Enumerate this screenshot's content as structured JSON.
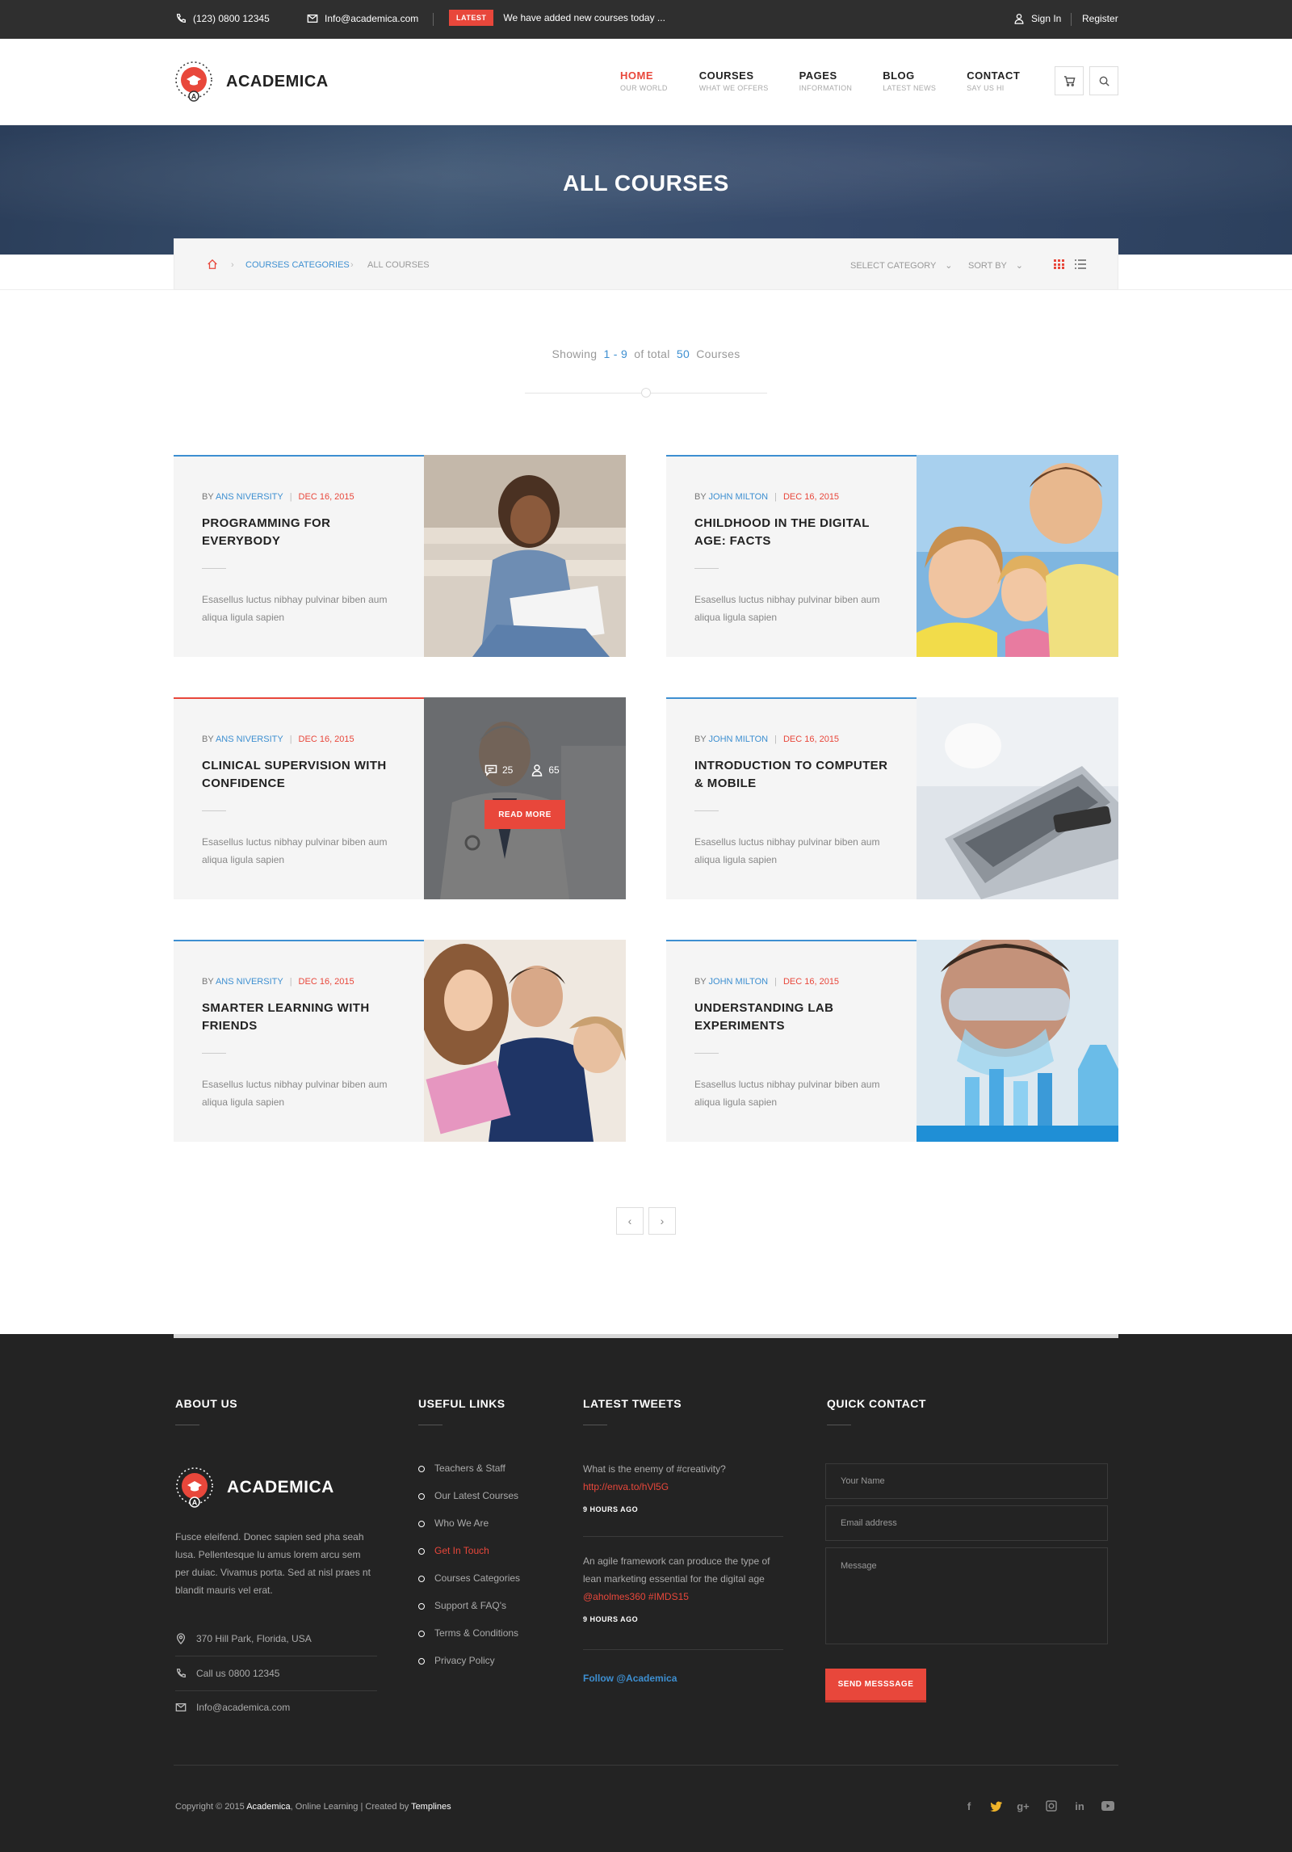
{
  "topbar": {
    "phone": "(123) 0800 12345",
    "email": "Info@academica.com",
    "latest_badge": "LATEST",
    "latest_text": "We have added new courses today ...",
    "sign_in": "Sign In",
    "register": "Register"
  },
  "brand": {
    "name": "ACADEMICA",
    "logo_letter": "A"
  },
  "nav": [
    {
      "title": "HOME",
      "sub": "OUR WORLD"
    },
    {
      "title": "COURSES",
      "sub": "WHAT WE OFFERS"
    },
    {
      "title": "PAGES",
      "sub": "INFORMATION"
    },
    {
      "title": "BLOG",
      "sub": "LATEST NEWS"
    },
    {
      "title": "CONTACT",
      "sub": "SAY US HI"
    }
  ],
  "hero": {
    "title": "ALL COURSES"
  },
  "breadcrumb": {
    "category": "COURSES CATEGORIES",
    "current": "ALL COURSES",
    "select_category": "SELECT CATEGORY",
    "sort_by": "SORT BY"
  },
  "showing": {
    "prefix": "Showing",
    "range": "1 - 9",
    "of_total": "of  total",
    "total": "50",
    "suffix": "Courses"
  },
  "courses": [
    {
      "by": "BY",
      "author": "ANS NIVERSITY",
      "date": "DEC 16, 2015",
      "title": "PROGRAMMING FOR EVERYBODY",
      "desc": "Esasellus luctus nibhay pulvinar biben aum aliqua ligula sapien"
    },
    {
      "by": "BY",
      "author": "JOHN MILTON",
      "date": "DEC 16, 2015",
      "title": "CHILDHOOD IN THE DIGITAL AGE: FACTS",
      "desc": "Esasellus luctus nibhay pulvinar biben aum aliqua ligula sapien"
    },
    {
      "by": "BY",
      "author": "ANS NIVERSITY",
      "date": "DEC 16, 2015",
      "title": "CLINICAL SUPERVISION WITH CONFIDENCE",
      "desc": "Esasellus luctus nibhay pulvinar biben aum aliqua ligula sapien",
      "comments": "25",
      "students": "65",
      "read_more": "READ MORE"
    },
    {
      "by": "BY",
      "author": "JOHN MILTON",
      "date": "DEC 16, 2015",
      "title": "INTRODUCTION TO COMPUTER & MOBILE",
      "desc": "Esasellus luctus nibhay pulvinar biben aum aliqua ligula sapien"
    },
    {
      "by": "BY",
      "author": "ANS NIVERSITY",
      "date": "DEC 16, 2015",
      "title": "SMARTER LEARNING WITH FRIENDS",
      "desc": "Esasellus luctus nibhay pulvinar biben aum aliqua ligula sapien"
    },
    {
      "by": "BY",
      "author": "JOHN MILTON",
      "date": "DEC 16, 2015",
      "title": "UNDERSTANDING LAB EXPERIMENTS",
      "desc": "Esasellus luctus nibhay pulvinar biben aum aliqua ligula sapien"
    }
  ],
  "pager": {
    "prev": "‹",
    "next": "›"
  },
  "footer": {
    "about_title": "ABOUT US",
    "links_title": "USEFUL LINKS",
    "tweets_title": "LATEST TWEETS",
    "contact_title": "QUICK CONTACT",
    "about_text": "Fusce eleifend. Donec sapien sed pha seah lusa. Pellentesque lu amus lorem arcu sem per duiac. Vivamus porta. Sed at nisl praes nt blandit mauris vel erat.",
    "address": "370 Hill Park, Florida, USA",
    "phone": "Call us 0800 12345",
    "email": "Info@academica.com",
    "links": [
      "Teachers & Staff",
      "Our Latest Courses",
      "Who We Are",
      "Get In Touch",
      "Courses Categories",
      "Support & FAQ's",
      "Terms & Conditions",
      "Privacy Policy"
    ],
    "tweet1_text": "What is the enemy of #creativity?",
    "tweet1_link": "http://enva.to/hVl5G",
    "tweet1_ago": "9 HOURS AGO",
    "tweet2_text": "An agile framework can produce the type of lean marketing essential for the digital age",
    "tweet2_tags": "@aholmes360 #IMDS15",
    "tweet2_ago": "9 HOURS AGO",
    "follow": "Follow @Academica",
    "name_placeholder": "Your Name",
    "email_placeholder": "Email address",
    "message_placeholder": "Message",
    "send": "SEND MESSSAGE",
    "copyright_prefix": "Copyright © 2015",
    "copyright_brand": "Academica",
    "copyright_mid": ", Online Learning  |  Created by",
    "copyright_by": "Templines"
  },
  "colors": {
    "accent": "#e8473b",
    "link": "#3d8fd1",
    "dark": "#2f2f2f",
    "footer": "#232323"
  },
  "icons": [
    "phone-icon",
    "mail-icon",
    "user-icon",
    "cart-icon",
    "search-icon",
    "home-icon",
    "grid-view-icon",
    "list-view-icon",
    "comment-icon",
    "student-icon",
    "location-icon",
    "facebook-icon",
    "twitter-icon",
    "google-plus-icon",
    "instagram-icon",
    "linkedin-icon",
    "youtube-icon"
  ]
}
